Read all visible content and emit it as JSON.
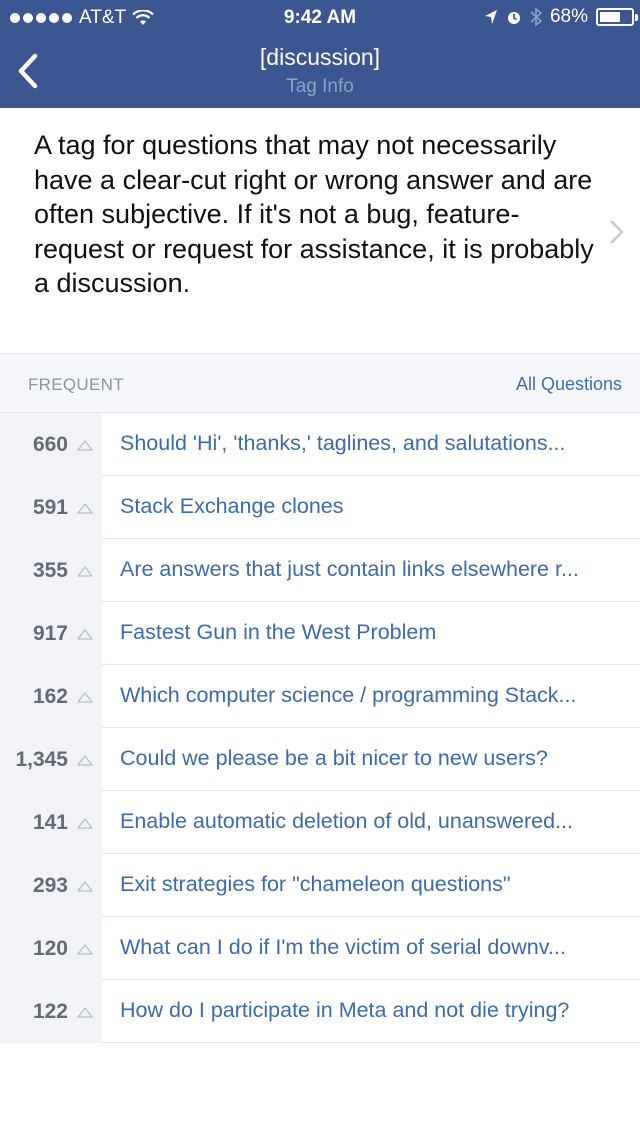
{
  "status_bar": {
    "carrier": "AT&T",
    "time": "9:42 AM",
    "battery_percent_label": "68%",
    "battery_level": 0.68
  },
  "nav": {
    "title": "[discussion]",
    "subtitle": "Tag Info",
    "back_icon": "chevron-left-icon"
  },
  "description": "A tag for questions that may not necessarily have a clear-cut right or wrong answer and are often subjective. If it's not a bug, feature-request or request for assistance, it is probably a discussion.",
  "section": {
    "label": "FREQUENT",
    "link": "All Questions"
  },
  "questions": [
    {
      "score": "660",
      "title": "Should 'Hi', 'thanks,' taglines, and salutations..."
    },
    {
      "score": "591",
      "title": "Stack Exchange clones"
    },
    {
      "score": "355",
      "title": "Are answers that just contain links elsewhere r..."
    },
    {
      "score": "917",
      "title": "Fastest Gun in the West Problem"
    },
    {
      "score": "162",
      "title": "Which computer science / programming Stack..."
    },
    {
      "score": "1,345",
      "title": "Could we please be a bit nicer to new users?"
    },
    {
      "score": "141",
      "title": "Enable automatic deletion of old, unanswered..."
    },
    {
      "score": "293",
      "title": "Exit strategies for \"chameleon questions\""
    },
    {
      "score": "120",
      "title": "What can I do if I'm the victim of serial downv..."
    },
    {
      "score": "122",
      "title": "How do I participate in Meta and not die trying?"
    }
  ],
  "colors": {
    "nav_background": "#3b5690",
    "link": "#3d6aa8"
  }
}
